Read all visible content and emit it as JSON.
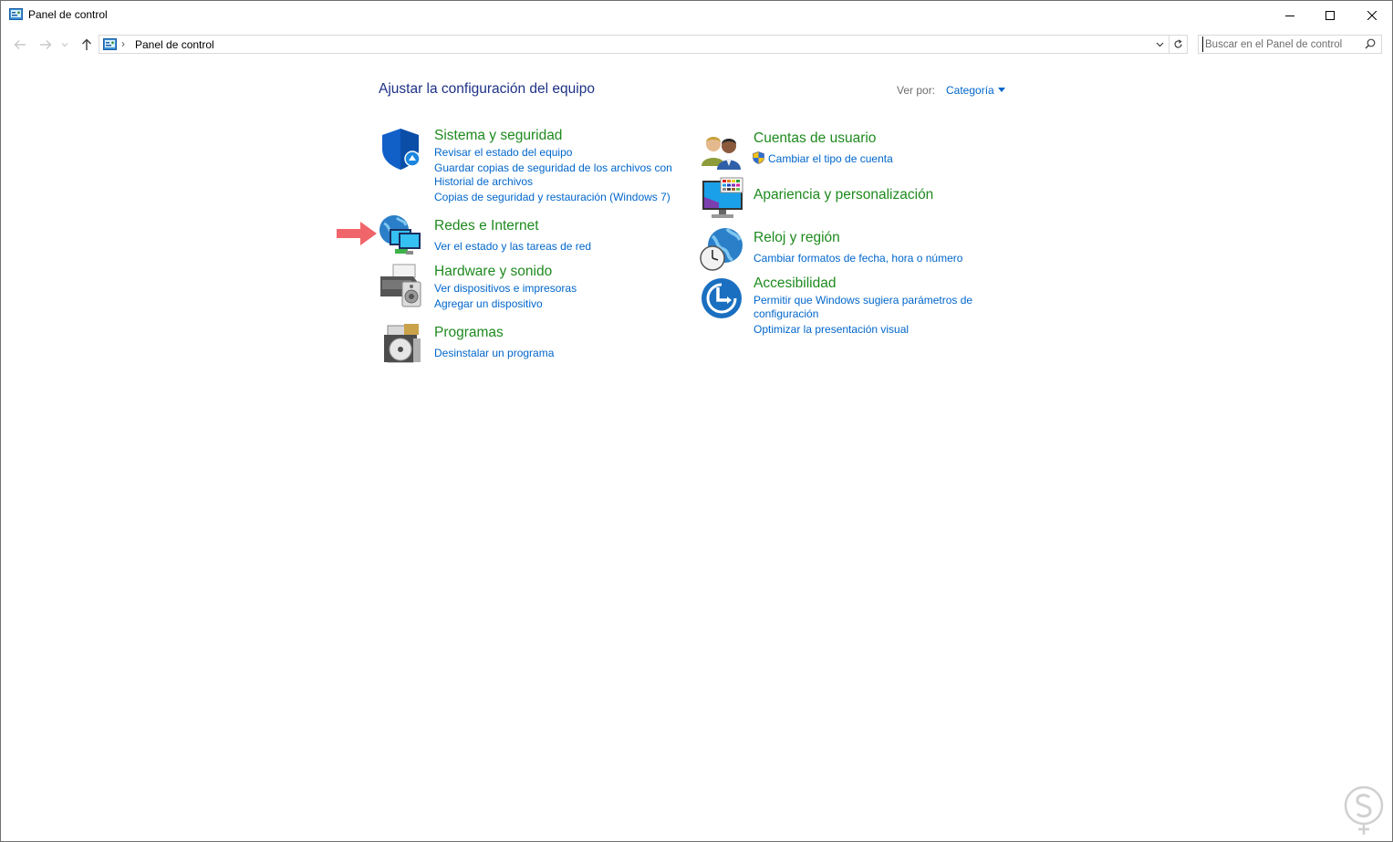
{
  "window": {
    "title": "Panel de control",
    "icon": "control-panel-icon",
    "controls": {
      "minimize": "minimize-icon",
      "maximize": "maximize-icon",
      "close": "close-icon"
    }
  },
  "addressbar": {
    "nav_back": "back-arrow-icon",
    "nav_forward": "forward-arrow-icon",
    "nav_recent": "chevron-down-icon",
    "nav_up": "up-arrow-icon",
    "separator": "›",
    "path": "Panel de control",
    "search_placeholder": "Buscar en el Panel de control"
  },
  "main": {
    "title": "Ajustar la configuración del equipo",
    "view_by_label": "Ver por:",
    "view_by_value": "Categoría"
  },
  "categories_left": [
    {
      "icon": "shield-icon",
      "title": "Sistema y seguridad",
      "links": [
        "Revisar el estado del equipo",
        "Guardar copias de seguridad de los archivos con",
        "Historial de archivos",
        "Copias de seguridad y restauración (Windows 7)"
      ]
    },
    {
      "icon": "network-globe-icon",
      "title": "Redes e Internet",
      "links": [
        "Ver el estado y las tareas de red"
      ]
    },
    {
      "icon": "printer-speaker-icon",
      "title": "Hardware y sonido",
      "links": [
        "Ver dispositivos e impresoras",
        "Agregar un dispositivo"
      ]
    },
    {
      "icon": "programs-disc-icon",
      "title": "Programas",
      "links": [
        "Desinstalar un programa"
      ]
    }
  ],
  "categories_right": [
    {
      "icon": "users-icon",
      "title": "Cuentas de usuario",
      "links": [
        "Cambiar el tipo de cuenta"
      ],
      "link_badge": "uac-shield-icon"
    },
    {
      "icon": "monitor-palette-icon",
      "title": "Apariencia y personalización",
      "links": []
    },
    {
      "icon": "clock-globe-icon",
      "title": "Reloj y región",
      "links": [
        "Cambiar formatos de fecha, hora o número"
      ]
    },
    {
      "icon": "accessibility-icon",
      "title": "Accesibilidad",
      "links": [
        "Permitir que Windows sugiera parámetros de",
        "configuración",
        "Optimizar la presentación visual"
      ]
    }
  ],
  "annotation": {
    "icon": "pointer-arrow-icon",
    "color": "#f0656a"
  },
  "colors": {
    "title_blue": "#1e3287",
    "link_blue": "#0066cc",
    "category_green": "#1e8a1e"
  }
}
